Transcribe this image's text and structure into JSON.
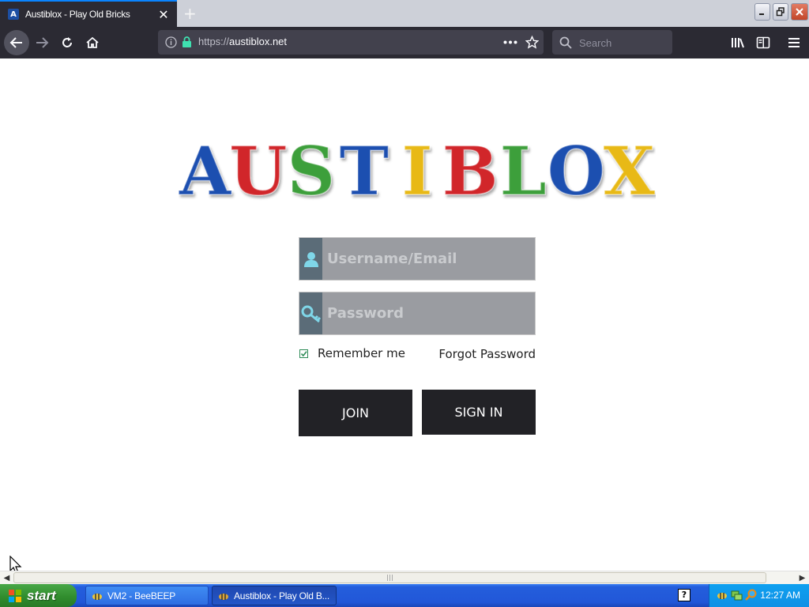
{
  "browser": {
    "tab_title": "Austiblox - Play Old Bricks",
    "tab_favicon_letter": "A",
    "newtab_label": "+",
    "url_prefix": "https://",
    "url_domain": "austiblox.net",
    "search_placeholder": "Search",
    "window_buttons": [
      "minimize",
      "restore",
      "close"
    ],
    "nav_icons": [
      "back-arrow-icon",
      "forward-arrow-icon",
      "reload-icon",
      "home-icon",
      "info-icon",
      "lock-icon",
      "page-actions-icon",
      "bookmark-star-icon",
      "search-icon",
      "library-icon",
      "sidebar-icon",
      "menu-icon"
    ]
  },
  "page": {
    "logo_text": "AUSTIBLOX",
    "logo_colors": [
      "#1f4fb0",
      "#d1262b",
      "#3e9f3b",
      "#1f4fb0",
      "#e8b914",
      "#d1262b",
      "#3e9f3b",
      "#1f4fb0",
      "#e8b914"
    ],
    "username_placeholder": "Username/Email",
    "password_placeholder": "Password",
    "remember_label": "Remember me",
    "remember_checked": true,
    "forgot_label": "Forgot Password",
    "join_label": "JOIN",
    "signin_label": "SIGN IN",
    "field_color": "#9a9ca1",
    "icon_color": "#7fd6e8",
    "button_color": "#222226"
  },
  "taskbar": {
    "start_label": "start",
    "tasks": [
      {
        "label": "VM2 - BeeBEEP",
        "active": false
      },
      {
        "label": "Austiblox - Play Old B...",
        "active": true
      }
    ],
    "clock": "12:27 AM"
  }
}
